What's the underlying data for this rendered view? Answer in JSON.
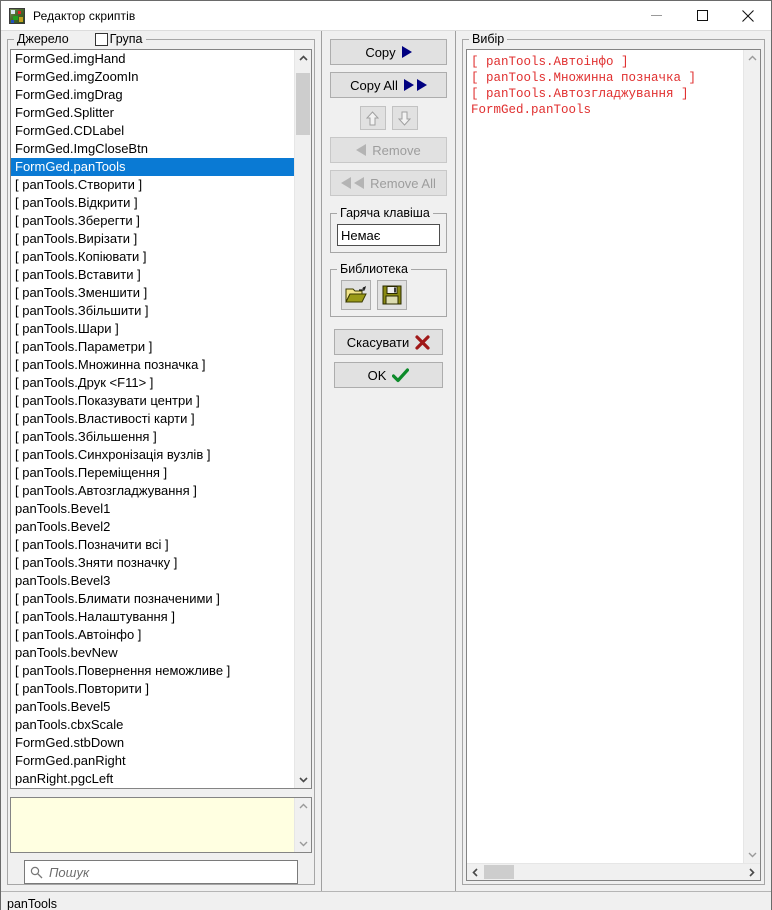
{
  "window": {
    "title": "Редактор скриптів",
    "icon": "script-editor-icon",
    "minimize_label": "—",
    "maximize_label": "□",
    "close_label": "✕"
  },
  "source_panel": {
    "legend": "Джерело",
    "group_checkbox_label": "Група",
    "group_checked": false,
    "selected_index": 6,
    "items": [
      "FormGed.imgHand",
      "FormGed.imgZoomIn",
      "FormGed.imgDrag",
      "FormGed.Splitter",
      "FormGed.CDLabel",
      "FormGed.ImgCloseBtn",
      "FormGed.panTools",
      "[ panTools.Створити ]",
      "[ panTools.Відкрити ]",
      "[ panTools.Зберегти ]",
      "[ panTools.Вирізати ]",
      "[ panTools.Копіювати ]",
      "[ panTools.Вставити ]",
      "[ panTools.Зменшити ]",
      "[ panTools.Збільшити ]",
      "[ panTools.Шари ]",
      "[ panTools.Параметри ]",
      "[ panTools.Множинна позначка ]",
      "[ panTools.Друк <F11> ]",
      "[ panTools.Показувати центри ]",
      "[ panTools.Властивості карти ]",
      "[ panTools.Збільшення ]",
      "[ panTools.Синхронізація вузлів ]",
      "[ panTools.Переміщення ]",
      "[ panTools.Автозгладжування ]",
      "panTools.Bevel1",
      "panTools.Bevel2",
      "[ panTools.Позначити всі ]",
      "[ panTools.Зняти позначку ]",
      "panTools.Bevel3",
      "[ panTools.Блимати позначеними ]",
      "[ panTools.Налаштування ]",
      "[ panTools.Автоінфо ]",
      "panTools.bevNew",
      "[ panTools.Повернення неможливе ]",
      "[ panTools.Повторити ]",
      "panTools.Bevel5",
      "panTools.cbxScale",
      "FormGed.stbDown",
      "FormGed.panRight",
      "panRight.pgcLeft"
    ],
    "memo_value": "",
    "search_placeholder": "Пошук",
    "search_value": "",
    "search_icon": "search-icon"
  },
  "center_panel": {
    "copy_label": "Copy",
    "copy_all_label": "Copy All",
    "move_up_icon": "arrow-up-icon",
    "move_down_icon": "arrow-down-icon",
    "remove_label": "Remove",
    "remove_all_label": "Remove All",
    "remove_enabled": false,
    "remove_all_enabled": false,
    "hotkey_legend": "Гаряча клавіша",
    "hotkey_value": "Немає",
    "library_legend": "Библиотека",
    "library_open_icon": "open-folder-icon",
    "library_save_icon": "floppy-save-icon",
    "cancel_label": "Скасувати",
    "ok_label": "OK"
  },
  "selection_panel": {
    "legend": "Вибір",
    "items": [
      "[ panTools.Автоінфо ]",
      "[ panTools.Множинна позначка ]",
      "[ panTools.Автозгладжування ]",
      "FormGed.panTools"
    ],
    "text_color": "#e03030"
  },
  "status_bar": {
    "text": "panTools"
  }
}
